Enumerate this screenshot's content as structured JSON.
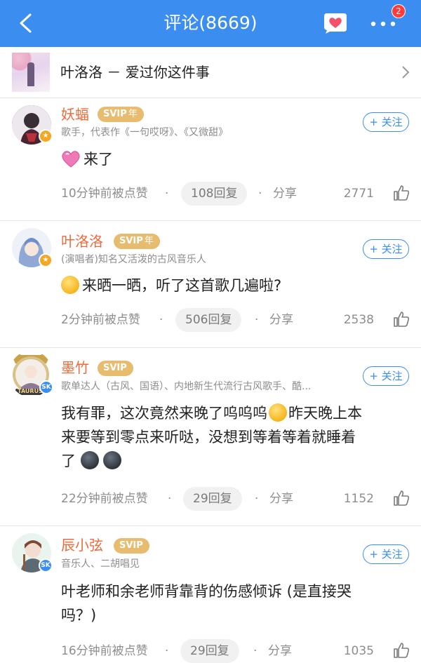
{
  "header": {
    "title": "评论(8669)",
    "badge_count": "2"
  },
  "song": {
    "title": "叶洛洛 － 爱过你这件事",
    "cover_text": "爱过你这件事"
  },
  "comments": [
    {
      "name": "妖蝠",
      "svip": "SVIP",
      "svip_year": "年",
      "desc": "歌手，代表作《一句哎呀》、《又微甜》",
      "follow": "+ 关注",
      "text": "来了",
      "time": "10分钟前被点赞",
      "replies": "108回复",
      "share": "分享",
      "likes": "2771"
    },
    {
      "name": "叶洛洛",
      "svip": "SVIP",
      "svip_year": "年",
      "desc": "(演唱者)知名又活泼的古风音乐人",
      "follow": "+ 关注",
      "text": "来晒一晒，听了这首歌几遍啦?",
      "time": "2分钟前被点赞",
      "replies": "506回复",
      "share": "分享",
      "likes": "2538"
    },
    {
      "name": "墨竹",
      "svip": "SVIP",
      "desc": "歌单达人（古风、国语）、内地新生代流行古风歌手、酷...",
      "follow": "+ 关注",
      "text_line1_a": "我有罪，这次竟然来晚了呜呜呜",
      "text_line1_b": "昨天晚上本",
      "text_line2": "来要等到零点来听哒，没想到等着等着就睡着",
      "text_line3": "了",
      "avatar_label": "TAURUS",
      "time": "22分钟前被点赞",
      "replies": "29回复",
      "share": "分享",
      "likes": "1152"
    },
    {
      "name": "辰小弦",
      "svip": "SVIP",
      "desc": "音乐人、二胡唱见",
      "follow": "+ 关注",
      "text_line1": "叶老师和余老师背靠背的伤感倾诉 (是直接哭",
      "text_line2": "吗？)",
      "time": "16分钟前被点赞",
      "replies": "29回复",
      "share": "分享",
      "likes": "1035"
    }
  ],
  "colors": {
    "header_bg": "#3b8ef0",
    "name": "#ef6a3a",
    "svip_bg": "#e8bc6f",
    "follow": "#3b8ef0",
    "badge": "#ff3b3b"
  },
  "icons": [
    "back-arrow-icon",
    "heart-message-icon",
    "more-dots-icon",
    "chevron-right-icon",
    "thumbs-up-icon",
    "dot-separator"
  ]
}
